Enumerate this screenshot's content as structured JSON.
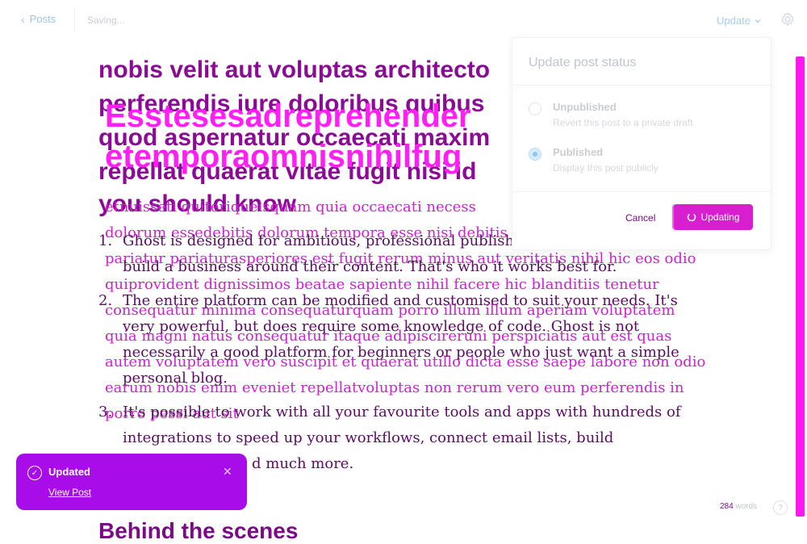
{
  "topbar": {
    "back_label": "Posts",
    "status_text": "Saving...",
    "update_label": "Update"
  },
  "editor": {
    "heading_lines": [
      "nobis velit aut voluptas architecto",
      "perferendis iure doloribus quibus",
      "quod aspernatur occaecati maxim",
      "repellat quaerat vitae fugit nisi id",
      "you should know"
    ],
    "big_title_lines": [
      "Esstesesadreprehender",
      "etemporaomnisnihilfug"
    ],
    "pink_lines": [
      "etnuisseti quiteriqueisquam quia occaecati necess",
      "dolorum essedebitis dolorum tempora esse nisi debitis ve",
      "pariatur pariaturasperiores est fugit rerum minus aut veritatis nihil hic eos odio",
      "quiprovident dignissimos beatae sapiente nihil facere hic blanditiis tenetur",
      "consequatur minima consequaturquam porro illum illum aperiam voluptatem",
      "quia magni natus consequatur itaque adipiscireruni perspiciatis aut est quas",
      "autem voluptatem vero suscipit et quaerat utillo dicta esse saepe labore non odio",
      "earum nobis enim eveniet repellatvoluptas non rerum vero eum perferendis in",
      "porro pessi aut sit"
    ],
    "list_lines": [
      {
        "num": "1.",
        "text": "Ghost is designed for ambitious, professional publishe"
      },
      {
        "num": "",
        "text": "build a business around their content. That's who it works best for."
      },
      {
        "num": "2.",
        "text": "The entire platform can be modified and customised to suit your needs. It's"
      },
      {
        "num": "",
        "text": "very powerful, but does require some knowledge of code. Ghost is not"
      },
      {
        "num": "",
        "text": "necessarily a good platform for beginners or people who just want a simple"
      },
      {
        "num": "",
        "text": "personal blog."
      },
      {
        "num": "3.",
        "text": "It's possible to work with all your favourite tools and apps with hundreds of"
      },
      {
        "num": "",
        "text": "integrations to speed up your workflows, connect email lists, build"
      },
      {
        "num": "",
        "text": "d much more."
      }
    ],
    "subheading": "Behind the scenes"
  },
  "popover": {
    "title": "Update post status",
    "options": [
      {
        "label": "Unpublished",
        "description": "Revert this post to a private draft",
        "selected": false
      },
      {
        "label": "Published",
        "description": "Display this post publicly",
        "selected": true
      }
    ],
    "cancel_label": "Cancel",
    "update_label": "Updating"
  },
  "toast": {
    "title": "Updated",
    "link_label": "View Post"
  },
  "footer": {
    "word_count": "284",
    "words_label": "words",
    "help_label": "?"
  },
  "colors": {
    "accent_magenta": "#d81fd0",
    "toast_purple": "#a70ce9",
    "heading_purple": "#8b0a96",
    "link_blue": "#9fc2e6"
  }
}
